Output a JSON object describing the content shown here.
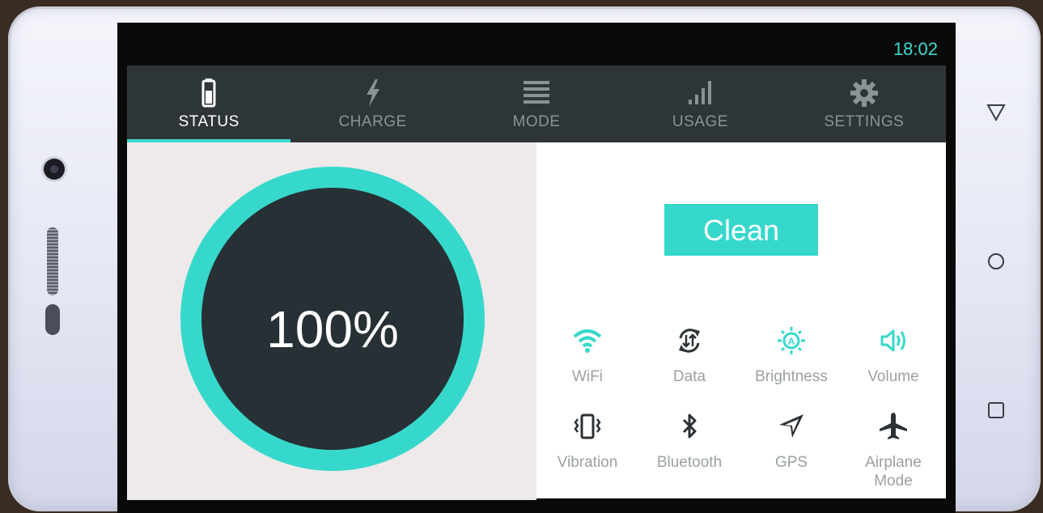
{
  "status_bar": {
    "time": "18:02"
  },
  "tabs": [
    {
      "label": "STATUS",
      "icon": "battery-icon",
      "active": true
    },
    {
      "label": "CHARGE",
      "icon": "bolt-icon",
      "active": false
    },
    {
      "label": "MODE",
      "icon": "list-icon",
      "active": false
    },
    {
      "label": "USAGE",
      "icon": "bar-signal-icon",
      "active": false
    },
    {
      "label": "SETTINGS",
      "icon": "gear-icon",
      "active": false
    }
  ],
  "battery": {
    "level_text": "100%",
    "level": 1.0
  },
  "clean_button": {
    "label": "Clean"
  },
  "toggles": [
    {
      "label": "WiFi",
      "icon": "wifi-icon",
      "active": true
    },
    {
      "label": "Data",
      "icon": "data-sync-icon",
      "active": false
    },
    {
      "label": "Brightness",
      "icon": "brightness-auto-icon",
      "active": true
    },
    {
      "label": "Volume",
      "icon": "volume-icon",
      "active": true
    },
    {
      "label": "Vibration",
      "icon": "vibration-icon",
      "active": false
    },
    {
      "label": "Bluetooth",
      "icon": "bluetooth-icon",
      "active": false
    },
    {
      "label": "GPS",
      "icon": "gps-icon",
      "active": false
    },
    {
      "label": "Airplane\nMode",
      "icon": "airplane-icon",
      "active": false
    }
  ],
  "nav": {
    "back": "back-icon",
    "home": "home-icon",
    "recents": "recents-icon"
  },
  "colors": {
    "accent": "#36d8cc",
    "tab_bar": "#2e3538",
    "dial": "#263035",
    "inactive_icon": "#2b3134"
  }
}
